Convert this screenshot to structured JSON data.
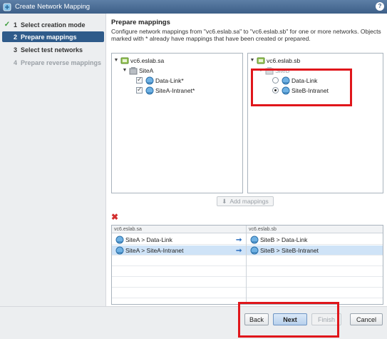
{
  "window": {
    "title": "Create Network Mapping",
    "help_label": "?"
  },
  "steps": [
    {
      "num": "1",
      "label": "Select creation mode",
      "state": "done"
    },
    {
      "num": "2",
      "label": "Prepare mappings",
      "state": "active"
    },
    {
      "num": "3",
      "label": "Select test networks",
      "state": "normal"
    },
    {
      "num": "4",
      "label": "Prepare reverse mappings",
      "state": "disabled"
    }
  ],
  "main": {
    "title": "Prepare mappings",
    "description": "Configure network mappings from \"vc6.eslab.sa\" to \"vc6.eslab.sb\" for one or more networks. Objects marked with * already have mappings that have been created or prepared."
  },
  "left_tree": {
    "root": "vc6.eslab.sa",
    "site": "SiteA",
    "networks": [
      {
        "label": "Data-Link*",
        "checked": true
      },
      {
        "label": "SiteA-Intranet*",
        "checked": true
      }
    ]
  },
  "right_tree": {
    "root": "vc6.eslab.sb",
    "site": "SiteB",
    "networks": [
      {
        "label": "Data-Link",
        "selected": false
      },
      {
        "label": "SiteB-Intranet",
        "selected": true
      }
    ]
  },
  "add_mappings_label": "Add mappings",
  "grid": {
    "col_left": "vc6.eslab.sa",
    "col_right": "vc6.eslab.sb",
    "rows": [
      {
        "source": "SiteA > Data-Link",
        "target": "SiteB > Data-Link",
        "selected": false
      },
      {
        "source": "SiteA > SiteA-Intranet",
        "target": "SiteB > SiteB-Intranet",
        "selected": true
      }
    ]
  },
  "buttons": {
    "back": "Back",
    "next": "Next",
    "finish": "Finish",
    "cancel": "Cancel"
  },
  "colors": {
    "highlight": "#e0161b",
    "active_step": "#2f5b8a",
    "selected_row": "#cfe3f7"
  }
}
